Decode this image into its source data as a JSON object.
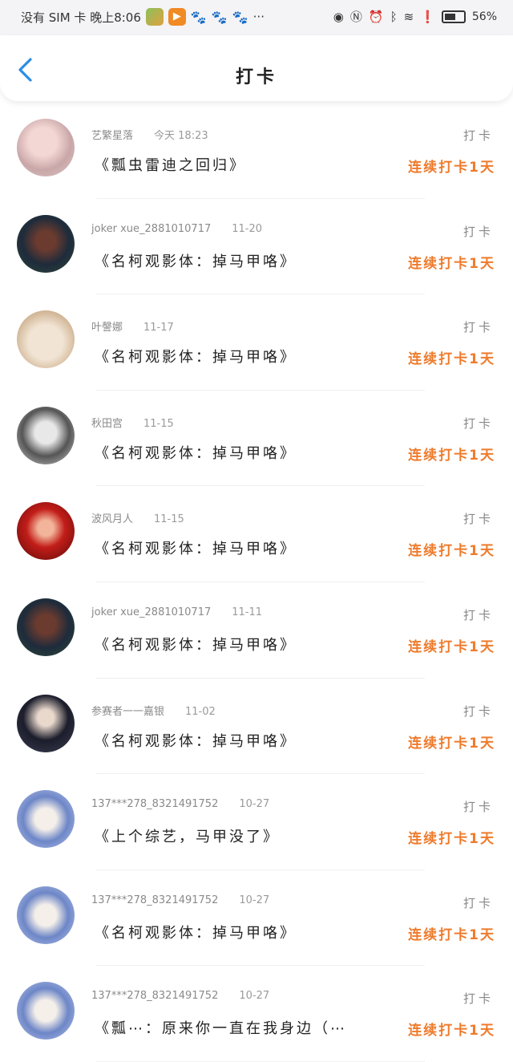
{
  "status_bar": {
    "carrier_text": "没有 SIM 卡 晚上8:06",
    "more": "···",
    "battery": "56%"
  },
  "header": {
    "title": "打卡"
  },
  "items": [
    {
      "avatar": "avatar-pink-hair-girl",
      "name": "艺繁星落",
      "time": "今天 18:23",
      "title": "《瓢虫雷迪之回归》",
      "tag": "打卡",
      "streak": "连续打卡1天"
    },
    {
      "avatar": "avatar-dark-suit-figure",
      "name": "joker xue_2881010717",
      "time": "11-20",
      "title": "《名柯观影体：掉马甲咯》",
      "tag": "打卡",
      "streak": "连续打卡1天"
    },
    {
      "avatar": "avatar-white-cat",
      "name": "叶謦娜",
      "time": "11-17",
      "title": "《名柯观影体：掉马甲咯》",
      "tag": "打卡",
      "streak": "连续打卡1天"
    },
    {
      "avatar": "avatar-gray-anime-boy",
      "name": "秋田宫",
      "time": "11-15",
      "title": "《名柯观影体：掉马甲咯》",
      "tag": "打卡",
      "streak": "连续打卡1天"
    },
    {
      "avatar": "avatar-red-hair-character",
      "name": "波风月人",
      "time": "11-15",
      "title": "《名柯观影体：掉马甲咯》",
      "tag": "打卡",
      "streak": "连续打卡1天"
    },
    {
      "avatar": "avatar-dark-suit-figure",
      "name": "joker xue_2881010717",
      "time": "11-11",
      "title": "《名柯观影体：掉马甲咯》",
      "tag": "打卡",
      "streak": "连续打卡1天"
    },
    {
      "avatar": "avatar-navy-cap-boy",
      "name": "参赛者一一嘉银",
      "time": "11-02",
      "title": "《名柯观影体：掉马甲咯》",
      "tag": "打卡",
      "streak": "连续打卡1天"
    },
    {
      "avatar": "avatar-blue-hair-girl",
      "name": "137***278_8321491752",
      "time": "10-27",
      "title": "《上个综艺，马甲没了》",
      "tag": "打卡",
      "streak": "连续打卡1天"
    },
    {
      "avatar": "avatar-blue-hair-girl",
      "name": "137***278_8321491752",
      "time": "10-27",
      "title": "《名柯观影体：掉马甲咯》",
      "tag": "打卡",
      "streak": "连续打卡1天"
    },
    {
      "avatar": "avatar-blue-hair-girl",
      "name": "137***278_8321491752",
      "time": "10-27",
      "title": "《瓢⋯：原来你一直在我身边（⋯",
      "tag": "打卡",
      "streak": "连续打卡1天"
    }
  ]
}
